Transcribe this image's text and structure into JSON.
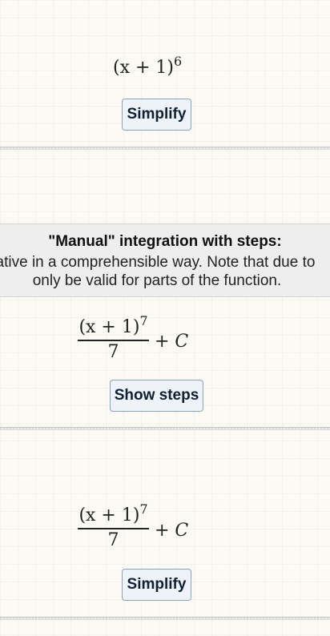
{
  "block1": {
    "expr_base": "(x + 1)",
    "expr_exp": "6",
    "button": "Simplify"
  },
  "info": {
    "title": "\"Manual\" integration with steps:",
    "line2": "ative in a comprehensible way. Note that due to",
    "line3": "only be valid for parts of the function."
  },
  "block2": {
    "num_base": "(x + 1)",
    "num_exp": "7",
    "den": "7",
    "plus_c": "+ C",
    "button": "Show steps"
  },
  "block3": {
    "num_base": "(x + 1)",
    "num_exp": "7",
    "den": "7",
    "plus_c": "+ C",
    "button": "Simplify"
  }
}
